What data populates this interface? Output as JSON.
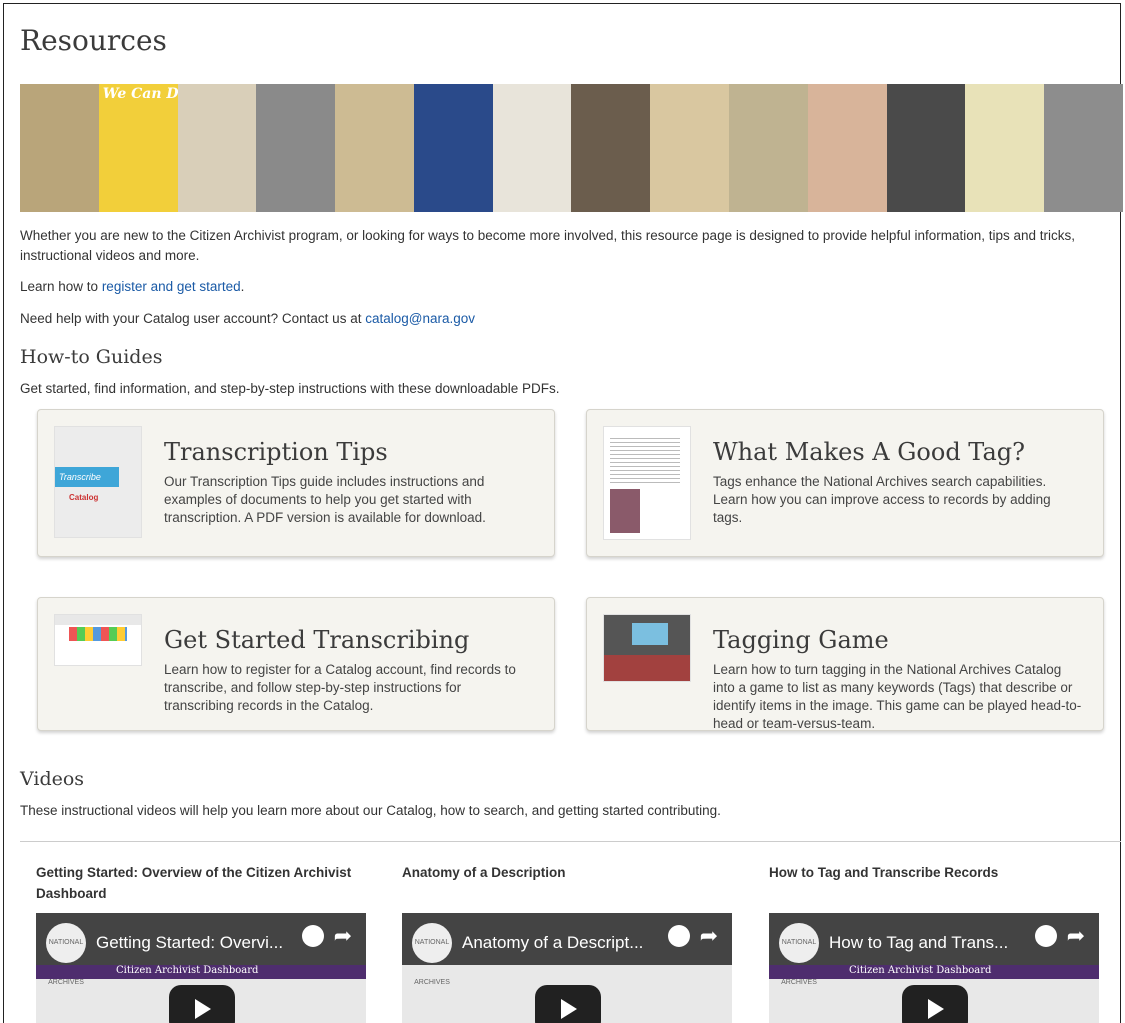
{
  "page": {
    "title": "Resources"
  },
  "banner": {
    "tile_labels": [
      "",
      "We Can Do It!",
      "",
      "",
      "",
      "",
      "",
      "",
      "",
      "",
      "",
      "",
      "",
      ""
    ],
    "tile_colors": [
      "#b9a57a",
      "#f2cf3a",
      "#d9cfb9",
      "#8a8a8a",
      "#cdbb93",
      "#2a4a8a",
      "#e8e4da",
      "#6b5d4d",
      "#d9c7a0",
      "#bfb391",
      "#d8b49a",
      "#4a4a4a",
      "#e8e2b8",
      "#8d8d8d"
    ]
  },
  "intro": {
    "line1": "Whether you are new to the Citizen Archivist program, or looking for ways to become more involved, this resource page is designed to provide helpful information, tips and tricks, instructional videos and more.",
    "learn_prefix": "Learn how to ",
    "learn_link": "register and get started",
    "learn_suffix": ".",
    "help_prefix": "Need help with your Catalog user account? Contact us at ",
    "help_link": "catalog@nara.gov"
  },
  "guides": {
    "heading": "How-to Guides",
    "subtitle": "Get started, find information, and step-by-step instructions with these downloadable PDFs.",
    "cards": [
      {
        "title": "Transcription Tips",
        "desc": "Our Transcription Tips guide includes instructions and examples of documents to help you get started with transcription. A PDF version is available for download.",
        "thumb_label": "Transcribe",
        "thumb_sub": "Catalog"
      },
      {
        "title": "What Makes A Good Tag?",
        "desc": "Tags enhance the National Archives search capabilities. Learn how you can improve access to records by adding tags."
      },
      {
        "title": "Get Started Transcribing",
        "desc": "Learn how to register for a Catalog account, find records to transcribe, and follow step-by-step instructions for transcribing records in the Catalog."
      },
      {
        "title": "Tagging Game",
        "desc": "Learn how to turn tagging in the National Archives Catalog into a game to list as many keywords (Tags) that describe or identify items in the image. This game can be played head-to-head or team-versus-team."
      }
    ]
  },
  "videos": {
    "heading": "Videos",
    "subtitle": "These instructional videos will help you learn more about our Catalog, how to search, and getting started contributing.",
    "items": [
      {
        "title": "Getting Started: Overview of the Citizen Archivist Dashboard",
        "overlay": "Getting Started: Overvi...",
        "bar_text": "Citizen Archivist Dashboard"
      },
      {
        "title": "Anatomy of a Description",
        "overlay": "Anatomy of a Descript...",
        "bar_text": ""
      },
      {
        "title": "How to Tag and Transcribe Records",
        "overlay": "How to Tag and Trans...",
        "bar_text": "Citizen Archivist Dashboard"
      }
    ],
    "logo_text": "NATIONAL ARCHIVES"
  }
}
